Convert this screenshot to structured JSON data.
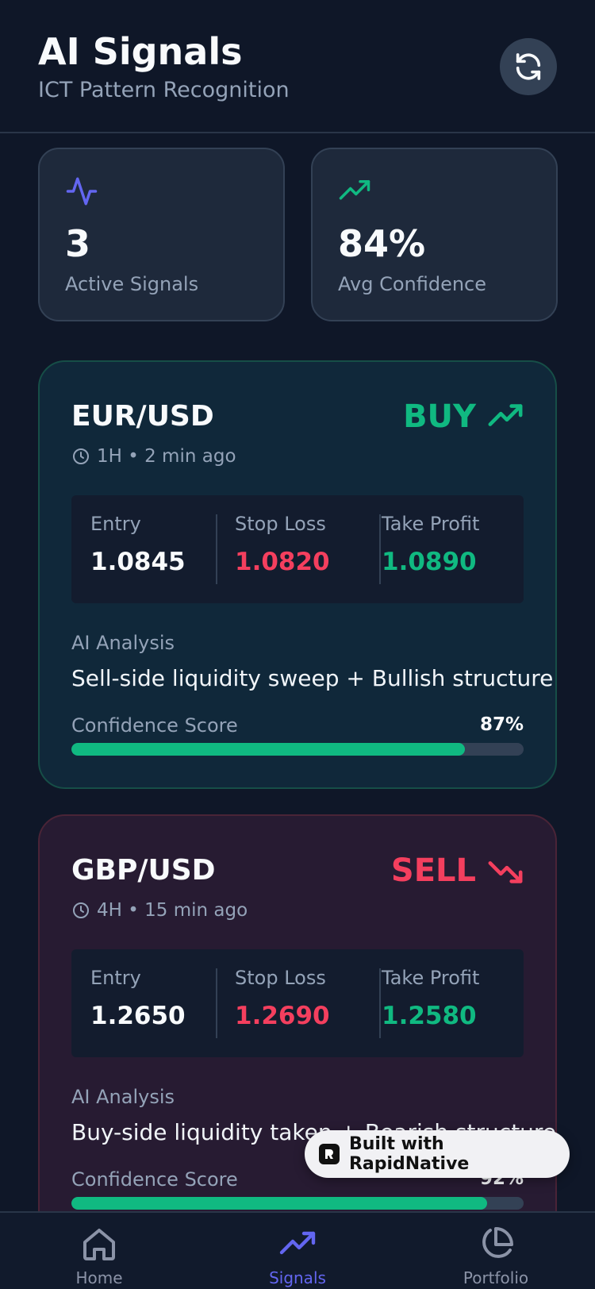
{
  "header": {
    "title": "AI Signals",
    "subtitle": "ICT Pattern Recognition",
    "refresh_icon": "refresh-icon"
  },
  "stats": [
    {
      "icon": "activity-icon",
      "value": "3",
      "label": "Active Signals",
      "color": "#6366f1"
    },
    {
      "icon": "trending-up-icon",
      "value": "84%",
      "label": "Avg Confidence",
      "color": "#10b981"
    }
  ],
  "signals": [
    {
      "pair": "EUR/USD",
      "meta": "1H • 2 min ago",
      "direction": "BUY",
      "direction_icon": "trending-up-icon",
      "entry_label": "Entry",
      "entry": "1.0845",
      "stop_label": "Stop Loss",
      "stop": "1.0820",
      "take_label": "Take Profit",
      "take": "1.0890",
      "ai_label": "AI Analysis",
      "ai_text": "Sell-side liquidity sweep + Bullish structure",
      "confidence_label": "Confidence Score",
      "confidence": "87%",
      "confidence_fraction": 0.87
    },
    {
      "pair": "GBP/USD",
      "meta": "4H • 15 min ago",
      "direction": "SELL",
      "direction_icon": "trending-down-icon",
      "entry_label": "Entry",
      "entry": "1.2650",
      "stop_label": "Stop Loss",
      "stop": "1.2690",
      "take_label": "Take Profit",
      "take": "1.2580",
      "ai_label": "AI Analysis",
      "ai_text": "Buy-side liquidity taken + Bearish structure",
      "confidence_label": "Confidence Score",
      "confidence": "92%",
      "confidence_fraction": 0.92
    }
  ],
  "badge": {
    "text": "Built with RapidNative"
  },
  "tabs": [
    {
      "label": "Home",
      "icon": "home-icon"
    },
    {
      "label": "Signals",
      "icon": "trending-up-icon",
      "active": true
    },
    {
      "label": "Portfolio",
      "icon": "pie-chart-icon"
    }
  ],
  "colors": {
    "background": "#0f1728",
    "accent": "#6366f1",
    "buy": "#10b981",
    "sell": "#f43f5e"
  }
}
